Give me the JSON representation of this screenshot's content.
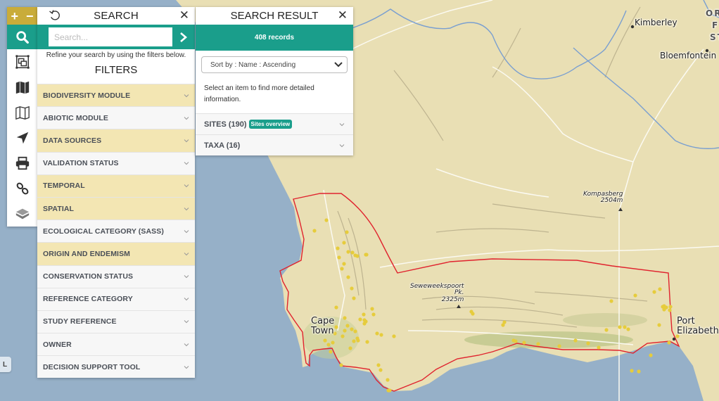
{
  "toolbar": {
    "zoom_in": "+",
    "zoom_out": "−",
    "buttons": [
      {
        "name": "search",
        "icon": "search-icon",
        "active": true
      },
      {
        "name": "select-area",
        "icon": "bounding-box-icon"
      },
      {
        "name": "basemap",
        "icon": "map-filled-icon"
      },
      {
        "name": "map-layers",
        "icon": "map-outline-icon"
      },
      {
        "name": "locate",
        "icon": "location-arrow-icon"
      },
      {
        "name": "print",
        "icon": "printer-icon"
      },
      {
        "name": "link",
        "icon": "link-icon"
      },
      {
        "name": "layers",
        "icon": "layers-icon"
      }
    ]
  },
  "search_panel": {
    "title": "SEARCH",
    "search_placeholder": "Search...",
    "search_value": "",
    "hint": "Refine your search by using the filters below.",
    "filters_title": "FILTERS",
    "filters": [
      {
        "label": "BIODIVERSITY MODULE",
        "highlighted": true
      },
      {
        "label": "ABIOTIC MODULE",
        "highlighted": false
      },
      {
        "label": "DATA SOURCES",
        "highlighted": true
      },
      {
        "label": "VALIDATION STATUS",
        "highlighted": false
      },
      {
        "label": "TEMPORAL",
        "highlighted": true
      },
      {
        "label": "SPATIAL",
        "highlighted": true
      },
      {
        "label": "ECOLOGICAL CATEGORY (SASS)",
        "highlighted": false
      },
      {
        "label": "ORIGIN AND ENDEMISM",
        "highlighted": true
      },
      {
        "label": "CONSERVATION STATUS",
        "highlighted": false
      },
      {
        "label": "REFERENCE CATEGORY",
        "highlighted": false
      },
      {
        "label": "STUDY REFERENCE",
        "highlighted": false
      },
      {
        "label": "OWNER",
        "highlighted": false
      },
      {
        "label": "DECISION SUPPORT TOOL",
        "highlighted": false
      }
    ]
  },
  "result_panel": {
    "title": "SEARCH RESULT",
    "record_count": "408 records",
    "sort_selected": "Sort by : Name : Ascending",
    "info": "Select an item to find more detailed information.",
    "sites_label": "SITES (190)",
    "sites_badge": "Sites overview",
    "taxa_label": "TAXA (16)"
  },
  "legend_button": "L",
  "map": {
    "labels": {
      "kimberley": "Kimberley",
      "bloemfontein": "Bloemfontein",
      "region_line1": "OR",
      "region_line2": "F",
      "region_line3": "ST",
      "kompasberg": "Kompasberg",
      "kompasberg_elev": "2504m",
      "seweweekspoort": "Seweweekspoort",
      "seweweekspoort_pk": "Pk.",
      "seweweekspoort_elev": "2325m",
      "cape": "Cape",
      "town": "Town",
      "port": "Port",
      "elizabeth": "Elizabeth"
    },
    "colors": {
      "land": "#e9dfb4",
      "water": "#96b0c8",
      "boundary": "#e0232e",
      "site_marker": "#e6cc3c",
      "river": "#7a9fd0"
    }
  }
}
